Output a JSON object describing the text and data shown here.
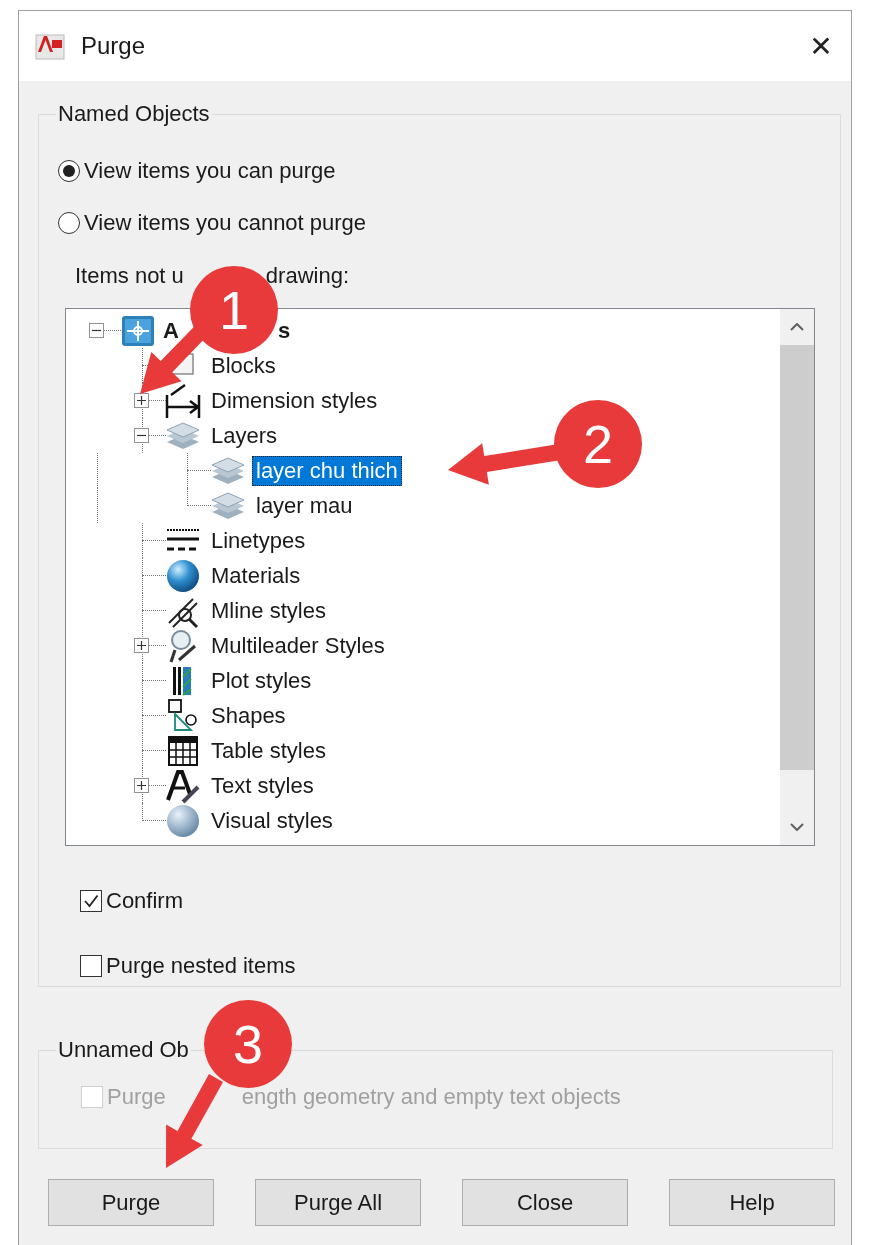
{
  "window": {
    "title": "Purge",
    "close_glyph": "✕"
  },
  "named_objects": {
    "title": "Named Objects",
    "view_options": [
      {
        "label": "View items you can purge",
        "selected": true
      },
      {
        "label": "View items you cannot purge",
        "selected": false
      }
    ],
    "tree_label_parts": [
      "Items not u",
      "drawing:"
    ],
    "tree": {
      "label_parts": [
        "A",
        "s"
      ],
      "kind": "drawing",
      "expanded": true,
      "selected": false,
      "children": [
        {
          "label": "Blocks",
          "kind": "blocks",
          "selected": false
        },
        {
          "label": "Dimension styles",
          "kind": "dimension",
          "expanded": false,
          "selected": false
        },
        {
          "label": "Layers",
          "kind": "layer",
          "expanded": true,
          "selected": false,
          "children": [
            {
              "label": "layer chu thich",
              "kind": "layer",
              "selected": true
            },
            {
              "label": "layer mau",
              "kind": "layer",
              "selected": false
            }
          ]
        },
        {
          "label": "Linetypes",
          "kind": "linetype",
          "selected": false
        },
        {
          "label": "Materials",
          "kind": "material",
          "selected": false
        },
        {
          "label": "Mline styles",
          "kind": "mline",
          "selected": false
        },
        {
          "label": "Multileader Styles",
          "kind": "multileader",
          "expanded": false,
          "selected": false
        },
        {
          "label": "Plot styles",
          "kind": "plot",
          "selected": false
        },
        {
          "label": "Shapes",
          "kind": "shape",
          "selected": false
        },
        {
          "label": "Table styles",
          "kind": "table",
          "selected": false
        },
        {
          "label": "Text styles",
          "kind": "text",
          "expanded": false,
          "selected": false
        },
        {
          "label": "Visual styles",
          "kind": "visual",
          "selected": false
        }
      ]
    },
    "options": [
      {
        "label": "Confirm",
        "checked": true
      },
      {
        "label": "Purge nested items",
        "checked": false
      }
    ]
  },
  "unnamed_objects": {
    "title": "Unnamed Ob",
    "options": [
      {
        "label_parts": [
          "Purge",
          "ength geometry and empty text objects"
        ],
        "checked": false,
        "disabled": true
      }
    ]
  },
  "buttons": [
    {
      "label": "Purge"
    },
    {
      "label": "Purge All"
    },
    {
      "label": "Close"
    },
    {
      "label": "Help"
    }
  ],
  "annotations": [
    {
      "label": "1"
    },
    {
      "label": "2"
    },
    {
      "label": "3"
    }
  ]
}
